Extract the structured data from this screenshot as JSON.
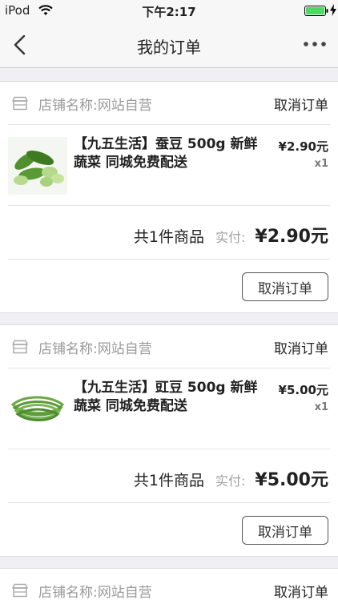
{
  "status": {
    "carrier": "iPod",
    "time": "下午2:17"
  },
  "nav": {
    "title": "我的订单",
    "back_icon": "chevron-left-icon",
    "more_icon": "more-dots-icon"
  },
  "orders": [
    {
      "store": "店铺名称:网站自营",
      "head_action": "取消订单",
      "product_name": "【九五生活】蚕豆 500g 新鲜蔬菜 同城免费配送",
      "price": "¥2.90元",
      "qty": "x1",
      "count": "共1件商品",
      "paid_label": "实付:",
      "paid_amount": "¥2.90元",
      "button": "取消订单",
      "image": "broad-beans-image"
    },
    {
      "store": "店铺名称:网站自营",
      "head_action": "取消订单",
      "product_name": "【九五生活】豇豆 500g 新鲜蔬菜 同城免费配送",
      "price": "¥5.00元",
      "qty": "x1",
      "count": "共1件商品",
      "paid_label": "实付:",
      "paid_amount": "¥5.00元",
      "button": "取消订单",
      "image": "long-beans-image"
    },
    {
      "store": "店铺名称:网站自营",
      "head_action": "取消订单"
    }
  ],
  "colors": {
    "background": "#efeff4",
    "battery": "#4cd964",
    "muted_text": "#9a9a9a"
  }
}
